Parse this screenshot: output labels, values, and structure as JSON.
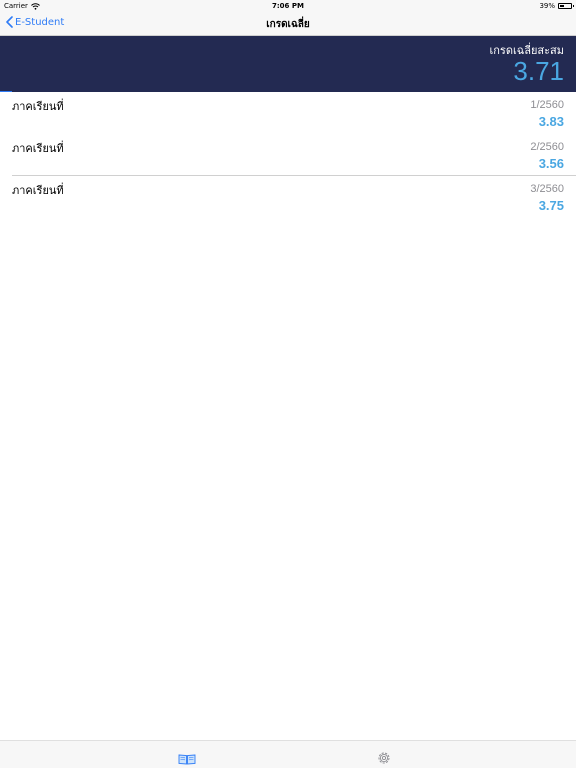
{
  "status_bar": {
    "carrier": "Carrier",
    "time": "7:06 PM",
    "battery": "39%",
    "battery_level": 0.39
  },
  "nav": {
    "back_label": "E-Student",
    "title": "เกรดเฉลี่ย"
  },
  "summary": {
    "label": "เกรดเฉลี่ยสะสม",
    "value": "3.71"
  },
  "semesters": [
    {
      "label": "ภาคเรียนที่",
      "term": "1/2560",
      "gpa": "3.83"
    },
    {
      "label": "ภาคเรียนที่",
      "term": "2/2560",
      "gpa": "3.56"
    },
    {
      "label": "ภาคเรียนที่",
      "term": "3/2560",
      "gpa": "3.75"
    }
  ],
  "tabs": [
    {
      "icon": "book-icon",
      "active": true
    },
    {
      "icon": "gear-icon",
      "active": false
    }
  ],
  "colors": {
    "header_bg": "#232a52",
    "accent": "#4aa7e2",
    "tint": "#2f7cf6"
  }
}
